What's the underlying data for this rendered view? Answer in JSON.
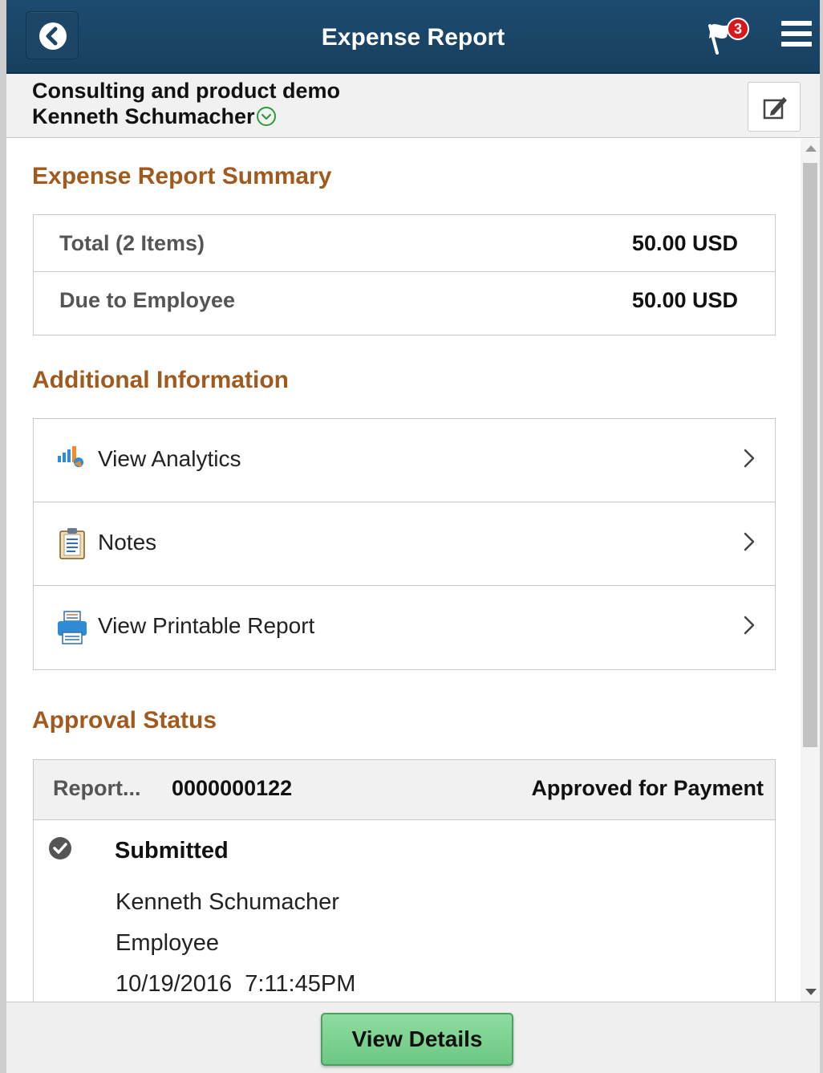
{
  "header": {
    "title": "Expense Report",
    "notification_count": "3"
  },
  "subheader": {
    "report_description": "Consulting and product demo",
    "employee_name": "Kenneth Schumacher"
  },
  "summary": {
    "title": "Expense Report Summary",
    "rows": [
      {
        "label": "Total (2 Items)",
        "value": "50.00 USD"
      },
      {
        "label": "Due to Employee",
        "value": "50.00 USD"
      }
    ]
  },
  "additional": {
    "title": "Additional Information",
    "items": [
      {
        "label": "View Analytics",
        "icon": "analytics-icon"
      },
      {
        "label": "Notes",
        "icon": "notes-icon"
      },
      {
        "label": "View Printable Report",
        "icon": "printer-icon"
      }
    ]
  },
  "approval": {
    "title": "Approval Status",
    "report_label": "Report...",
    "report_number": "0000000122",
    "status": "Approved for Payment",
    "step": {
      "title": "Submitted",
      "name": "Kenneth Schumacher",
      "role": "Employee",
      "timestamp": "10/19/2016  7:11:45PM"
    }
  },
  "footer": {
    "view_details_label": "View Details"
  },
  "colors": {
    "header_bg": "#1b4668",
    "section_title": "#a05a1e",
    "badge": "#d7191c",
    "primary_button": "#7fd494"
  }
}
